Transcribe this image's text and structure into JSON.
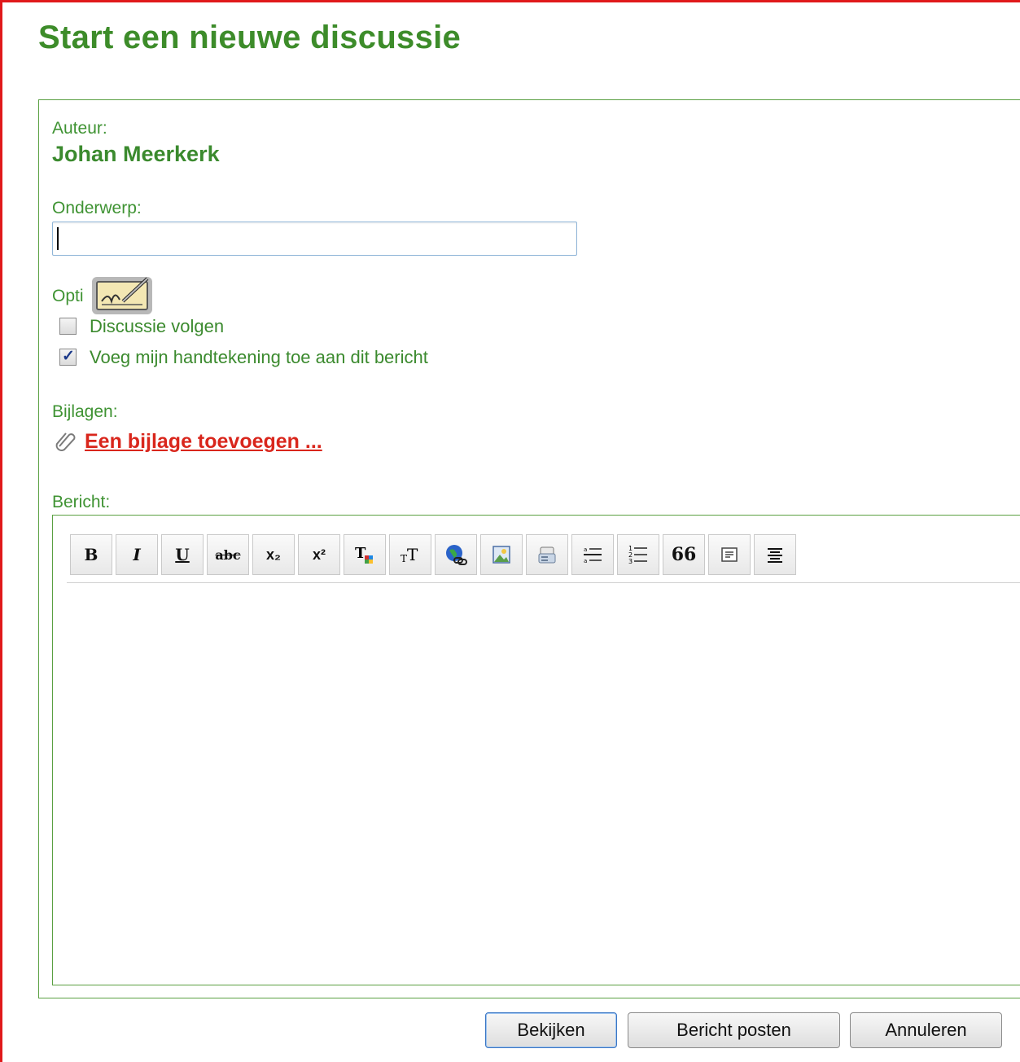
{
  "page": {
    "title": "Start een nieuwe discussie"
  },
  "form": {
    "author_label": "Auteur:",
    "author_name": "Johan Meerkerk",
    "subject_label": "Onderwerp:",
    "subject_value": "",
    "options_label": "Opti",
    "options": [
      {
        "label": "Discussie volgen",
        "checked": false
      },
      {
        "label": "Voeg mijn handtekening toe aan dit bericht",
        "checked": true
      }
    ],
    "attachments_label": "Bijlagen:",
    "attachment_link": "Een bijlage toevoegen ...",
    "message_label": "Bericht:"
  },
  "toolbar": {
    "buttons": [
      "bold",
      "italic",
      "underline",
      "strikethrough",
      "subscript",
      "superscript",
      "text-color",
      "font-size",
      "insert-link",
      "insert-image",
      "insert-media",
      "bulleted-list",
      "numbered-list",
      "quote",
      "code",
      "align"
    ],
    "glyphs": {
      "bold": "B",
      "italic": "I",
      "underline": "U",
      "strike": "abc",
      "sub": "x₂",
      "sup": "x²",
      "quote": "66"
    }
  },
  "buttons": {
    "preview": "Bekijken",
    "post": "Bericht posten",
    "cancel": "Annuleren"
  },
  "colors": {
    "accent_green": "#3d8c2a",
    "frame_red": "#e0191b",
    "link_red": "#d9261c"
  }
}
